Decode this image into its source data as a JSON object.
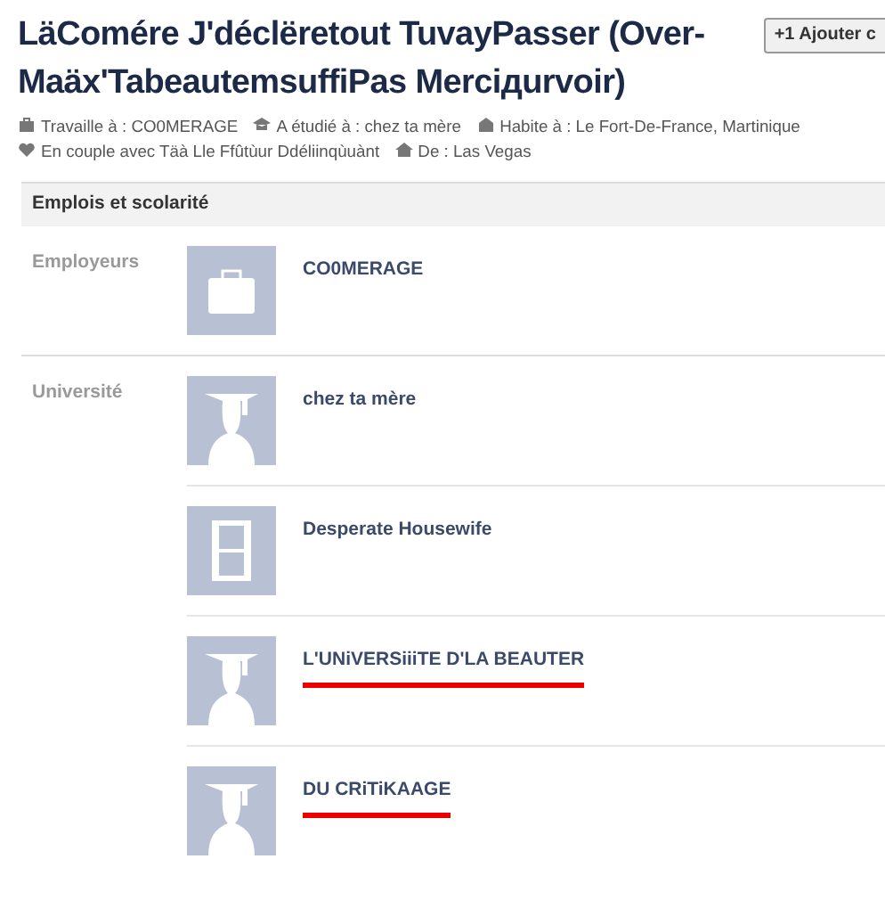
{
  "profile": {
    "name": "LäComére J'déclëretout TuvayPasser (Over-Maäx'TabeautemsuffiPas Merciдurvoir)",
    "add_button": {
      "icon_text": "+1",
      "label": "Ajouter c"
    },
    "info": [
      {
        "kind": "work",
        "text": "Travaille à : CO0MERAGE"
      },
      {
        "kind": "school",
        "text": "A étudié à : chez ta mère"
      },
      {
        "kind": "home",
        "text": "Habite à : Le Fort-De-France, Martinique"
      },
      {
        "kind": "heart",
        "text": "En couple avec Täà Lle Ffûtùur Ddéliinqùuànt"
      },
      {
        "kind": "house",
        "text": "De : Las Vegas"
      }
    ]
  },
  "section": {
    "title": "Emplois et scolarité",
    "groups": [
      {
        "label": "Employeurs",
        "entries": [
          {
            "kind": "briefcase",
            "name": "CO0MERAGE",
            "underlined": false
          }
        ]
      },
      {
        "label": "Université",
        "entries": [
          {
            "kind": "graduate",
            "name": "chez ta mère",
            "underlined": false
          },
          {
            "kind": "film",
            "name": "Desperate Housewife",
            "underlined": false
          },
          {
            "kind": "graduate",
            "name": "L'UNiVERSiiiTE D'LA BEAUTER",
            "underlined": true
          },
          {
            "kind": "graduate",
            "name": "DU CRiTiKAAGE",
            "underlined": true
          }
        ]
      }
    ]
  }
}
